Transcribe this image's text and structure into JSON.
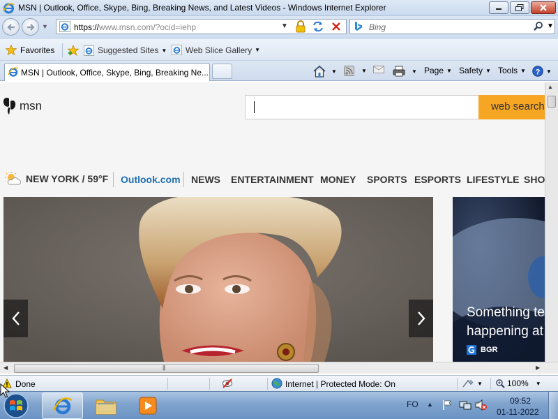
{
  "window": {
    "title": "MSN | Outlook, Office, Skype, Bing, Breaking News, and Latest Videos - Windows Internet Explorer"
  },
  "navbar": {
    "url_scheme": "https://",
    "url_rest": "www.msn.com/?ocid=iehp",
    "search_placeholder": "Bing"
  },
  "favorites_bar": {
    "favorites_label": "Favorites",
    "suggested_label": "Suggested Sites",
    "slice_label": "Web Slice Gallery"
  },
  "tabs": [
    {
      "label": "MSN | Outlook, Office, Skype, Bing, Breaking Ne..."
    }
  ],
  "command_bar": {
    "page_label": "Page",
    "safety_label": "Safety",
    "tools_label": "Tools"
  },
  "page": {
    "logo_text": "msn",
    "search_button": "web search",
    "weather": "NEW YORK / 59°F",
    "nav": [
      "Outlook.com",
      "NEWS",
      "ENTERTAINMENT",
      "MONEY",
      "SPORTS",
      "ESPORTS",
      "LIFESTYLE",
      "SHOP"
    ],
    "card2": {
      "title_line1": "Something te",
      "title_line2": "happening at",
      "source": "BGR"
    },
    "accent_color": "#f6a623",
    "outlook_color": "#1f6fb2"
  },
  "statusbar": {
    "status": "Done",
    "zone": "Internet | Protected Mode: On",
    "zoom": "100%"
  },
  "taskbar": {
    "language": "FO",
    "time": "09:52",
    "date": "01-11-2022"
  }
}
